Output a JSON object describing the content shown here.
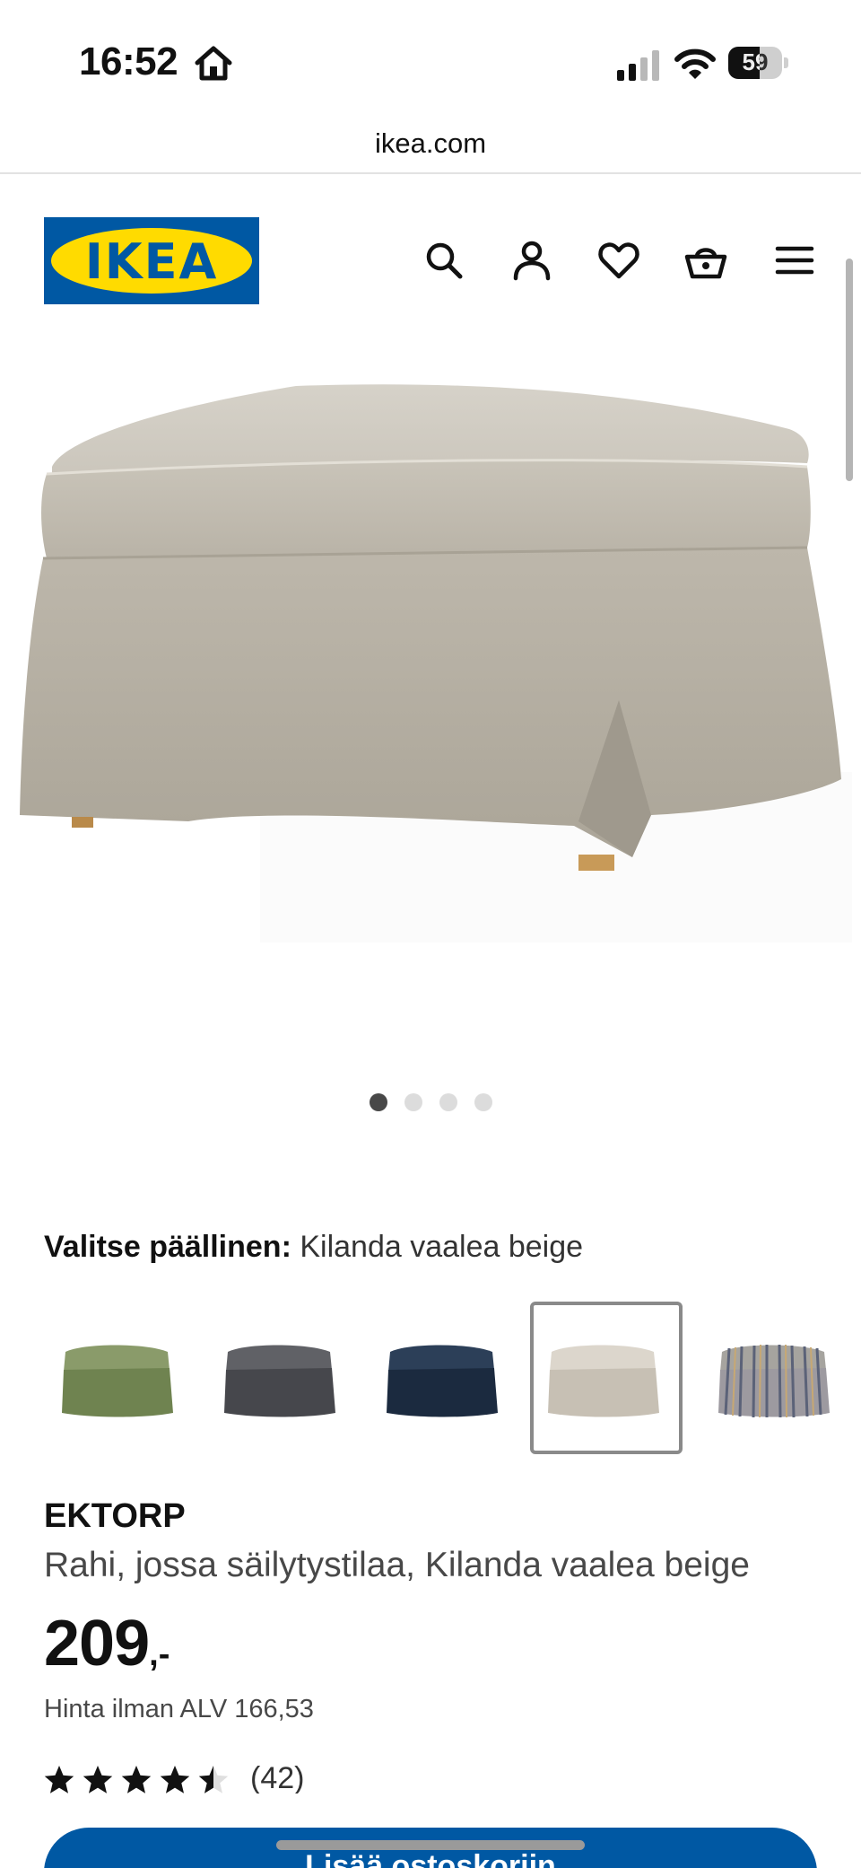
{
  "status_bar": {
    "time": "16:52",
    "battery": "59",
    "battery_level": 0.59
  },
  "browser": {
    "url": "ikea.com"
  },
  "header": {
    "logo_text": "IKEA",
    "icons": [
      "search-icon",
      "user-icon",
      "heart-icon",
      "basket-icon",
      "menu-icon"
    ]
  },
  "gallery": {
    "image_count": 4,
    "active_index": 0
  },
  "cover": {
    "label": "Valitse päällinen:",
    "value": "Kilanda vaalea beige",
    "swatches": [
      {
        "color": "#7b8d5c",
        "selected": false
      },
      {
        "color": "#515257",
        "selected": false
      },
      {
        "color": "#20324a",
        "selected": false
      },
      {
        "color": "#cdc5b8",
        "selected": true
      },
      {
        "color": "#8f8e95",
        "selected": false,
        "striped": true
      }
    ]
  },
  "product": {
    "brand": "EKTORP",
    "description": "Rahi, jossa säilytystilaa, Kilanda vaalea beige",
    "price": "209",
    "price_suffix": ",-",
    "vat_text": "Hinta ilman ALV 166,53",
    "rating": 4.5,
    "review_count": "(42)"
  },
  "cart_button": {
    "label": "Lisää ostoskoriin"
  },
  "colors": {
    "ikea_blue": "#0058a3",
    "ikea_yellow": "#ffdb00"
  }
}
